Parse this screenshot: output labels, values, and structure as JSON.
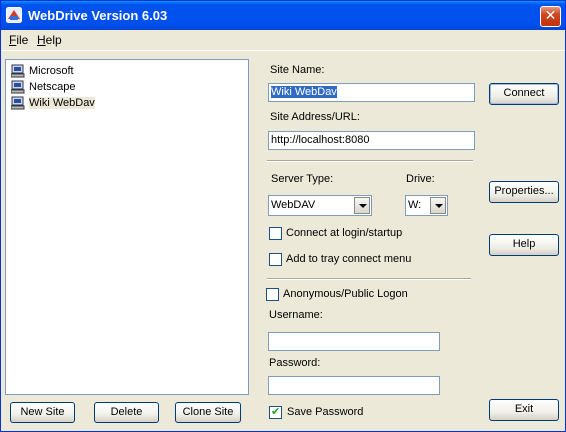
{
  "window": {
    "title": "WebDrive Version 6.03",
    "close_glyph": "✕"
  },
  "menu": {
    "file": "File",
    "help": "Help"
  },
  "sites": [
    {
      "label": "Microsoft",
      "selected": false
    },
    {
      "label": "Netscape",
      "selected": false
    },
    {
      "label": "Wiki WebDav",
      "selected": true
    }
  ],
  "left_buttons": {
    "new_site": "New Site",
    "delete": "Delete",
    "clone_site": "Clone Site"
  },
  "form": {
    "site_name_label": "Site Name:",
    "site_name_value": "Wiki WebDav",
    "site_address_label": "Site Address/URL:",
    "site_address_value": "http://localhost:8080",
    "server_type_label": "Server Type:",
    "server_type_value": "WebDAV",
    "drive_label": "Drive:",
    "drive_value": "W:",
    "connect_at_login_label": "Connect at login/startup",
    "connect_at_login_checked": false,
    "add_to_tray_label": "Add to tray connect menu",
    "add_to_tray_checked": false,
    "anonymous_label": "Anonymous/Public Logon",
    "anonymous_checked": false,
    "username_label": "Username:",
    "username_value": "",
    "password_label": "Password:",
    "password_value": "",
    "save_password_label": "Save Password",
    "save_password_checked": true
  },
  "right_buttons": {
    "connect": "Connect",
    "properties": "Properties...",
    "help": "Help",
    "exit": "Exit"
  }
}
